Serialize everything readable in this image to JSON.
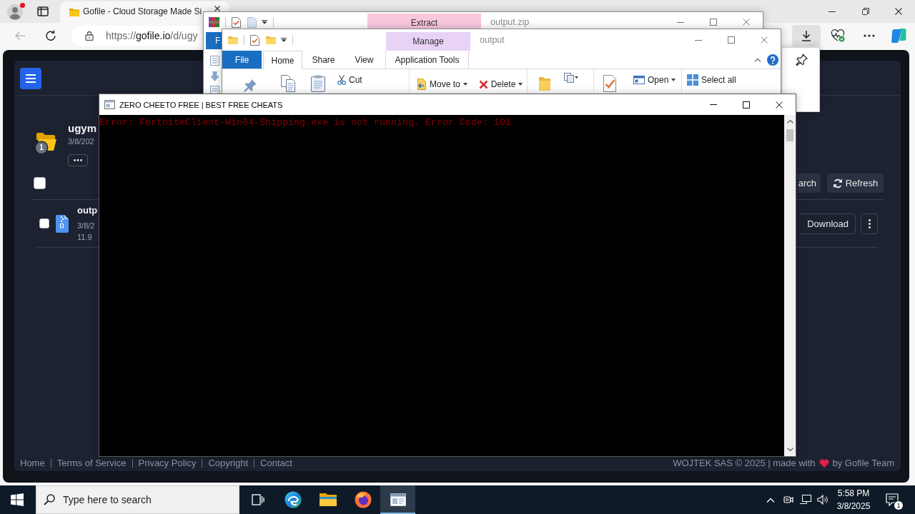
{
  "browser": {
    "tab_title": "Gofile - Cloud Storage Made Si",
    "url": {
      "scheme": "https://",
      "host": "gofile.io",
      "path": "/d/ugy"
    },
    "back_disabled": true,
    "downloads_open": true
  },
  "gofile": {
    "folder": {
      "name": "ugym",
      "date": "3/8/202",
      "count": "1"
    },
    "select_all": {
      "checked": false
    },
    "actions": [
      {
        "kind": "search",
        "label": "arch"
      },
      {
        "kind": "refresh",
        "label": "Refresh"
      }
    ],
    "files": [
      {
        "name": "outp",
        "date": "3/8/2",
        "size": "11.9",
        "checked": false,
        "action": "Download"
      }
    ],
    "footer_links": [
      "Home",
      "Terms of Service",
      "Privacy Policy",
      "Copyright",
      "Contact"
    ],
    "credit": {
      "before": "WOJTEK SAS © 2025 | made with",
      "after": "by Gofile Team"
    }
  },
  "winrar": {
    "title": "output.zip",
    "context_tab": "Extract",
    "file_tab": "F"
  },
  "explorer": {
    "title": "output",
    "context_tab": "Manage",
    "tabs": [
      {
        "label": "File",
        "kind": "file",
        "selected": false
      },
      {
        "label": "Home",
        "kind": "tab",
        "selected": true
      },
      {
        "label": "Share",
        "kind": "tab",
        "selected": false
      },
      {
        "label": "View",
        "kind": "tab",
        "selected": false
      },
      {
        "label": "Application Tools",
        "kind": "context",
        "selected": false
      }
    ],
    "ribbon": {
      "cut": "Cut",
      "move_to": "Move to",
      "delete": "Delete",
      "open": "Open",
      "select_all": "Select all"
    }
  },
  "console": {
    "title": "ZERO CHEETO FREE | BEST FREE CHEATS",
    "lines": [
      "Error: FortniteClient-Win64-Shipping.exe is not running. Error Code: 101"
    ]
  },
  "taskbar": {
    "search": {
      "placeholder": "Type here to search"
    },
    "apps": [
      {
        "kind": "task-view",
        "selected": false
      },
      {
        "kind": "edge",
        "selected": false
      },
      {
        "kind": "explorer",
        "selected": false
      },
      {
        "kind": "firefox",
        "selected": false
      },
      {
        "kind": "console",
        "selected": true
      }
    ],
    "time": "5:58 PM",
    "date": "3/8/2025",
    "notification_count": "1"
  }
}
